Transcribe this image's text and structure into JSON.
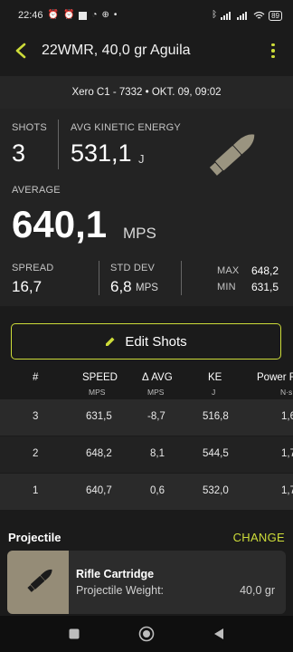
{
  "status_bar": {
    "time": "22:46",
    "battery": "89"
  },
  "header": {
    "title": "22WMR, 40,0 gr Aguila"
  },
  "session": {
    "info": "Xero C1 - 7332 • OKT. 09, 09:02"
  },
  "stats": {
    "shots_label": "SHOTS",
    "shots_value": "3",
    "ke_label": "AVG KINETIC ENERGY",
    "ke_value": "531,1",
    "ke_unit": "J",
    "average_label": "AVERAGE",
    "average_value": "640,1",
    "average_unit": "MPS",
    "spread_label": "SPREAD",
    "spread_value": "16,7",
    "stddev_label": "STD DEV",
    "stddev_value": "6,8",
    "stddev_unit": "MPS",
    "max_label": "MAX",
    "max_value": "648,2",
    "min_label": "MIN",
    "min_value": "631,5"
  },
  "edit_button": {
    "label": "Edit Shots"
  },
  "shots_table": {
    "columns": [
      {
        "label": "#",
        "unit": ""
      },
      {
        "label": "SPEED",
        "unit": "MPS"
      },
      {
        "label": "Δ AVG",
        "unit": "MPS"
      },
      {
        "label": "KE",
        "unit": "J"
      },
      {
        "label": "Power F",
        "unit": "N·s"
      }
    ],
    "rows": [
      {
        "num": "3",
        "speed": "631,5",
        "delta": "-8,7",
        "ke": "516,8",
        "power": "1,6"
      },
      {
        "num": "2",
        "speed": "648,2",
        "delta": "8,1",
        "ke": "544,5",
        "power": "1,7"
      },
      {
        "num": "1",
        "speed": "640,7",
        "delta": "0,6",
        "ke": "532,0",
        "power": "1,7"
      }
    ]
  },
  "projectile": {
    "section_title": "Projectile",
    "change_label": "CHANGE",
    "name": "Rifle Cartridge",
    "weight_label": "Projectile Weight:",
    "weight_value": "40,0 gr"
  },
  "icons": {
    "back": "chevron-left-icon",
    "menu": "more-vertical-icon",
    "edit": "pencil-icon",
    "cartridge": "cartridge-icon",
    "nav_recents": "square-icon",
    "nav_home": "circle-icon",
    "nav_back": "triangle-back-icon"
  },
  "colors": {
    "accent": "#cddc39",
    "background": "#1b1b1b",
    "cartridge_icon": "#9a9480",
    "thumb_background": "#958c77"
  }
}
